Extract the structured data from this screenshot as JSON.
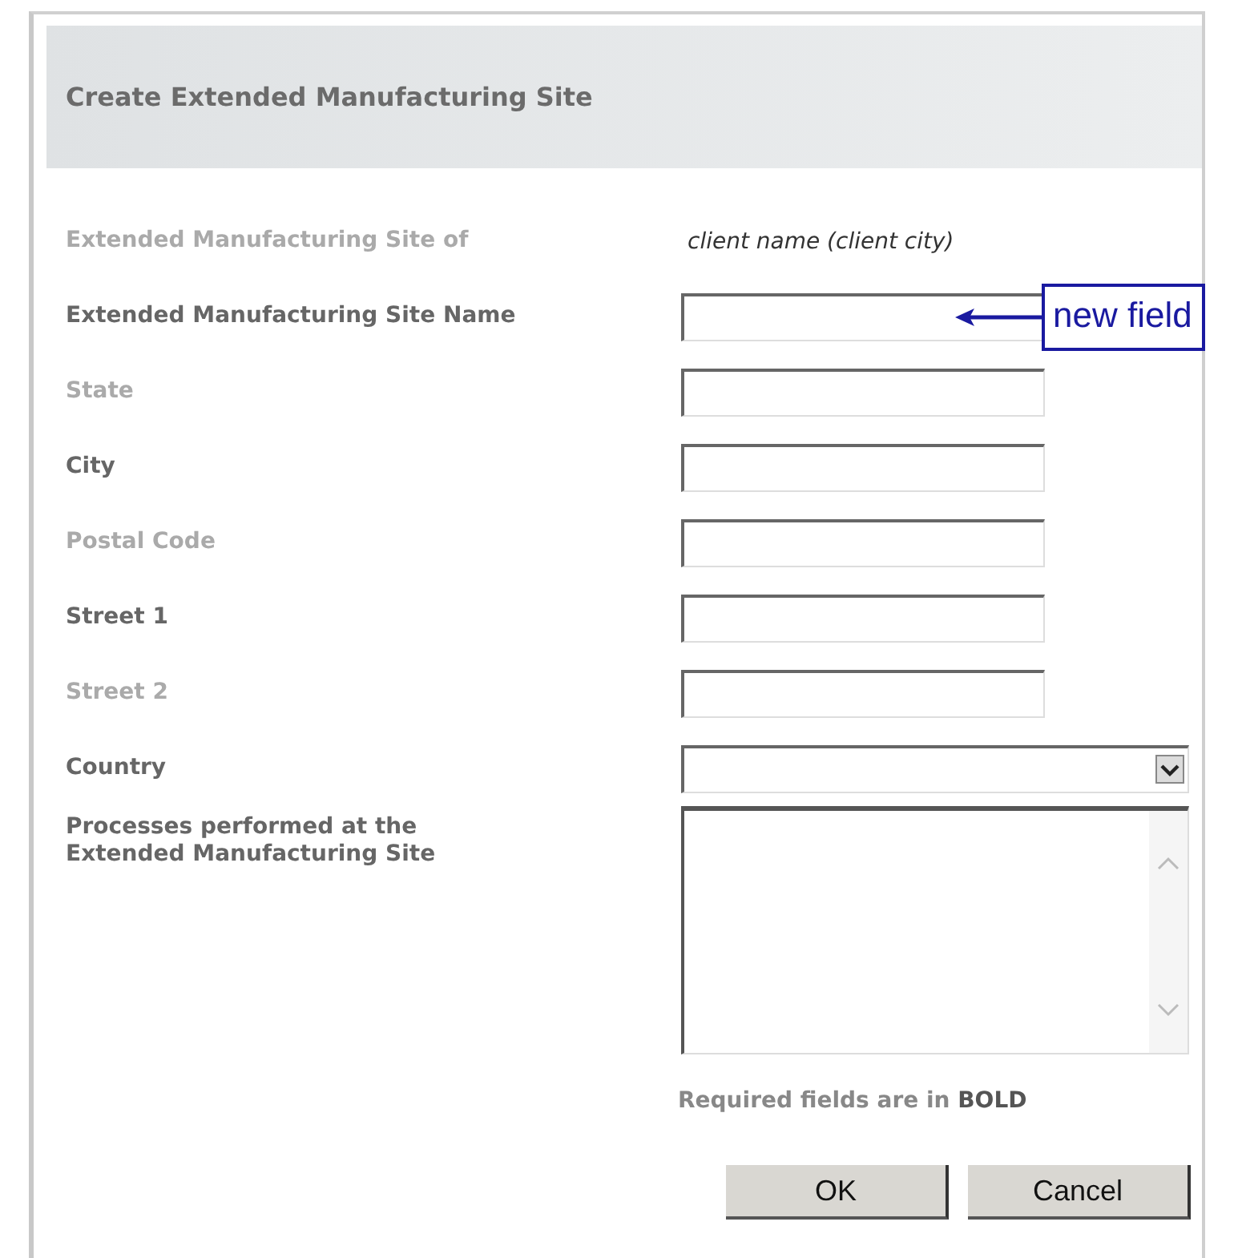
{
  "dialog": {
    "title": "Create Extended Manufacturing Site"
  },
  "fields": [
    {
      "kind": "static",
      "label": "Extended Manufacturing  Site of",
      "required": false,
      "value": "client name (client city)"
    },
    {
      "kind": "text",
      "label": "Extended Manufacturing  Site Name",
      "required": true
    },
    {
      "kind": "text",
      "label": "State",
      "required": false
    },
    {
      "kind": "text",
      "label": "City",
      "required": true
    },
    {
      "kind": "text",
      "label": "Postal Code",
      "required": false
    },
    {
      "kind": "text",
      "label": "Street 1",
      "required": true
    },
    {
      "kind": "text",
      "label": "Street 2",
      "required": false
    },
    {
      "kind": "select",
      "label": "Country",
      "required": true
    },
    {
      "kind": "textarea",
      "label": "Processes performed at the Extended Manufacturing  Site",
      "required": true
    }
  ],
  "callout": {
    "text": "new field"
  },
  "note": "Required fields are in **BOLD**",
  "buttons": [
    "OK",
    "Cancel"
  ]
}
